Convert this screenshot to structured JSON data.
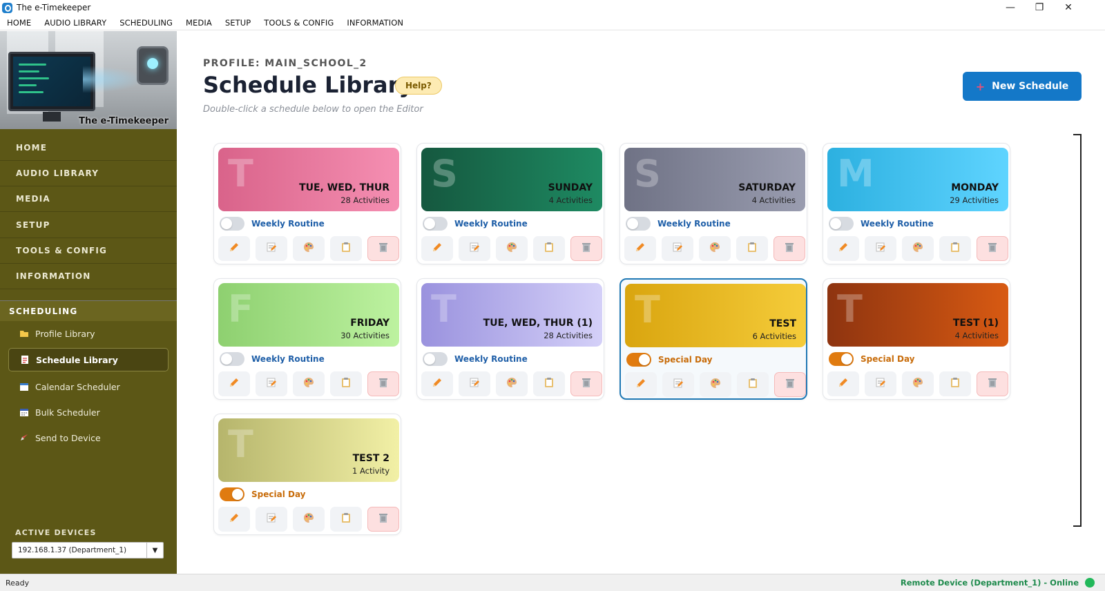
{
  "window": {
    "title": "The e-Timekeeper",
    "minimize": "—",
    "restore": "❐",
    "close": "✕"
  },
  "menu": [
    "HOME",
    "AUDIO LIBRARY",
    "SCHEDULING",
    "MEDIA",
    "SETUP",
    "TOOLS & CONFIG",
    "INFORMATION"
  ],
  "sidebar": {
    "brand": "The e-Timekeeper",
    "main_items": [
      "HOME",
      "AUDIO LIBRARY",
      "MEDIA",
      "SETUP",
      "TOOLS & CONFIG",
      "INFORMATION"
    ],
    "section": "SCHEDULING",
    "sub_items": [
      {
        "label": "Profile Library",
        "icon": "folder-icon",
        "active": false
      },
      {
        "label": "Schedule Library",
        "icon": "document-icon",
        "active": true
      },
      {
        "label": "Calendar Scheduler",
        "icon": "calendar-icon",
        "active": false
      },
      {
        "label": "Bulk Scheduler",
        "icon": "bulk-calendar-icon",
        "active": false
      },
      {
        "label": "Send to Device",
        "icon": "rocket-icon",
        "active": false
      }
    ],
    "active_devices_label": "ACTIVE DEVICES",
    "device_selected": "192.168.1.37  (Department_1)"
  },
  "header": {
    "profile": "PROFILE: MAIN_SCHOOL_2",
    "title": "Schedule Library",
    "help": "Help?",
    "subtitle": "Double-click a schedule below to open the Editor",
    "new_button": "New Schedule",
    "new_button_icon": "+"
  },
  "schedules": [
    {
      "letter": "T",
      "name": "TUE, WED, THUR",
      "count": "28 Activities",
      "mode": "Weekly Routine",
      "enabled": false,
      "colors": [
        "#d9638a",
        "#f58fb2"
      ]
    },
    {
      "letter": "S",
      "name": "SUNDAY",
      "count": "4 Activities",
      "mode": "Weekly Routine",
      "enabled": false,
      "colors": [
        "#15583f",
        "#1e8a62"
      ]
    },
    {
      "letter": "S",
      "name": "SATURDAY",
      "count": "4 Activities",
      "mode": "Weekly Routine",
      "enabled": false,
      "colors": [
        "#6f7285",
        "#9a9db0"
      ]
    },
    {
      "letter": "M",
      "name": "MONDAY",
      "count": "29 Activities",
      "mode": "Weekly Routine",
      "enabled": false,
      "colors": [
        "#2cb0e0",
        "#5fd4ff"
      ]
    },
    {
      "letter": "F",
      "name": "FRIDAY",
      "count": "30 Activities",
      "mode": "Weekly Routine",
      "enabled": false,
      "colors": [
        "#8ed070",
        "#bdf2a0"
      ]
    },
    {
      "letter": "T",
      "name": "TUE, WED, THUR (1)",
      "count": "28 Activities",
      "mode": "Weekly Routine",
      "enabled": false,
      "colors": [
        "#9a92de",
        "#d4d0f8"
      ]
    },
    {
      "letter": "T",
      "name": "TEST",
      "count": "6 Activities",
      "mode": "Special Day",
      "enabled": true,
      "colors": [
        "#d9a50f",
        "#f5cc3a"
      ],
      "selected": true
    },
    {
      "letter": "T",
      "name": "TEST (1)",
      "count": "4 Activities",
      "mode": "Special Day",
      "enabled": true,
      "colors": [
        "#8e3410",
        "#d85a12"
      ]
    },
    {
      "letter": "T",
      "name": "TEST 2",
      "count": "1 Activity",
      "mode": "Special Day",
      "enabled": true,
      "colors": [
        "#b6b56c",
        "#f2f0a6"
      ]
    }
  ],
  "actions": [
    {
      "name": "edit-button",
      "icon": "pencil-icon",
      "glyph": "✏️"
    },
    {
      "name": "rename-button",
      "icon": "note-edit-icon",
      "glyph": "📝"
    },
    {
      "name": "color-button",
      "icon": "palette-icon",
      "glyph": "🎨"
    },
    {
      "name": "copy-button",
      "icon": "clipboard-icon",
      "glyph": "📋"
    },
    {
      "name": "delete-button",
      "icon": "trash-icon",
      "glyph": "🗑"
    }
  ],
  "status": {
    "left": "Ready",
    "right": "Remote Device (Department_1) - Online",
    "dot_color": "#22b85a"
  }
}
